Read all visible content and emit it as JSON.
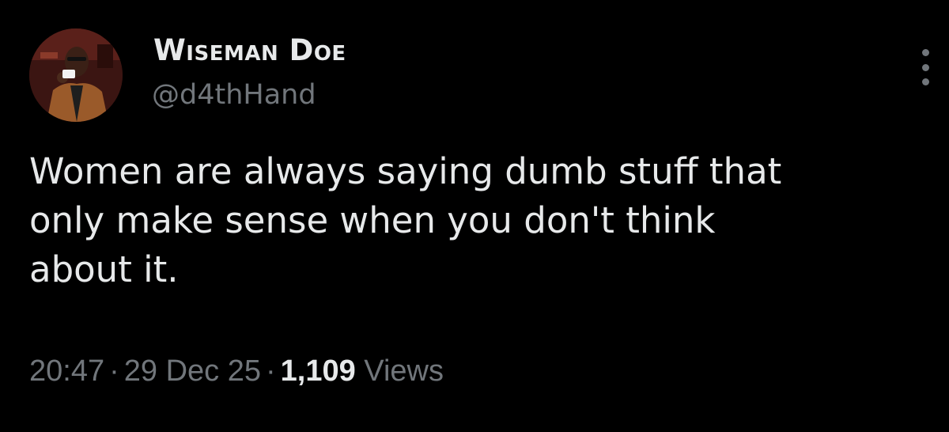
{
  "tweet": {
    "author": {
      "display_name": "Wiseman Doe",
      "handle": "@d4thHand",
      "avatar_icon": "profile-photo"
    },
    "text_lines": [
      "Women are always saying dumb stuff that",
      "only make sense when you don't think",
      "about it."
    ],
    "meta": {
      "time": "20:47",
      "separator": "·",
      "date": "29 Dec 25",
      "views_count": "1,109",
      "views_label": "Views"
    },
    "more_icon": "more-options-icon"
  },
  "colors": {
    "background": "#000000",
    "primary_text": "#e7e9ea",
    "secondary_text": "#71767b"
  }
}
